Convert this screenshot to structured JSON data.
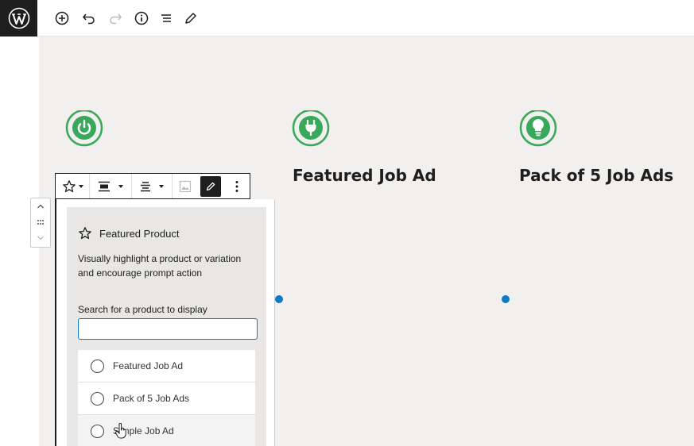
{
  "header": {
    "logo_icon": "wordpress-logo",
    "tools": [
      "add-block-icon",
      "undo-icon",
      "redo-icon",
      "info-icon",
      "list-view-icon",
      "edit-icon"
    ]
  },
  "columns": [
    {
      "title": "Featured Job Ad",
      "icon": "plug-icon"
    },
    {
      "title": "Pack of 5 Job Ads",
      "icon": "lightbulb-icon"
    }
  ],
  "first_column": {
    "icon": "power-icon"
  },
  "block_toolbar": {
    "items": [
      "star-icon",
      "align-wide-icon",
      "align-center-icon",
      "image-icon",
      "edit-pencil-icon",
      "more-options-icon"
    ]
  },
  "featured_product": {
    "title": "Featured Product",
    "description": "Visually highlight a product or variation and encourage prompt action",
    "search_label": "Search for a product to display",
    "search_value": "",
    "options": [
      {
        "label": "Featured Job Ad"
      },
      {
        "label": "Pack of 5 Job Ads"
      },
      {
        "label": "Simple Job Ad"
      }
    ]
  },
  "colors": {
    "accent_green": "#3aa85a",
    "selection_blue": "#0a7bc4",
    "dark": "#1e1e1e"
  }
}
